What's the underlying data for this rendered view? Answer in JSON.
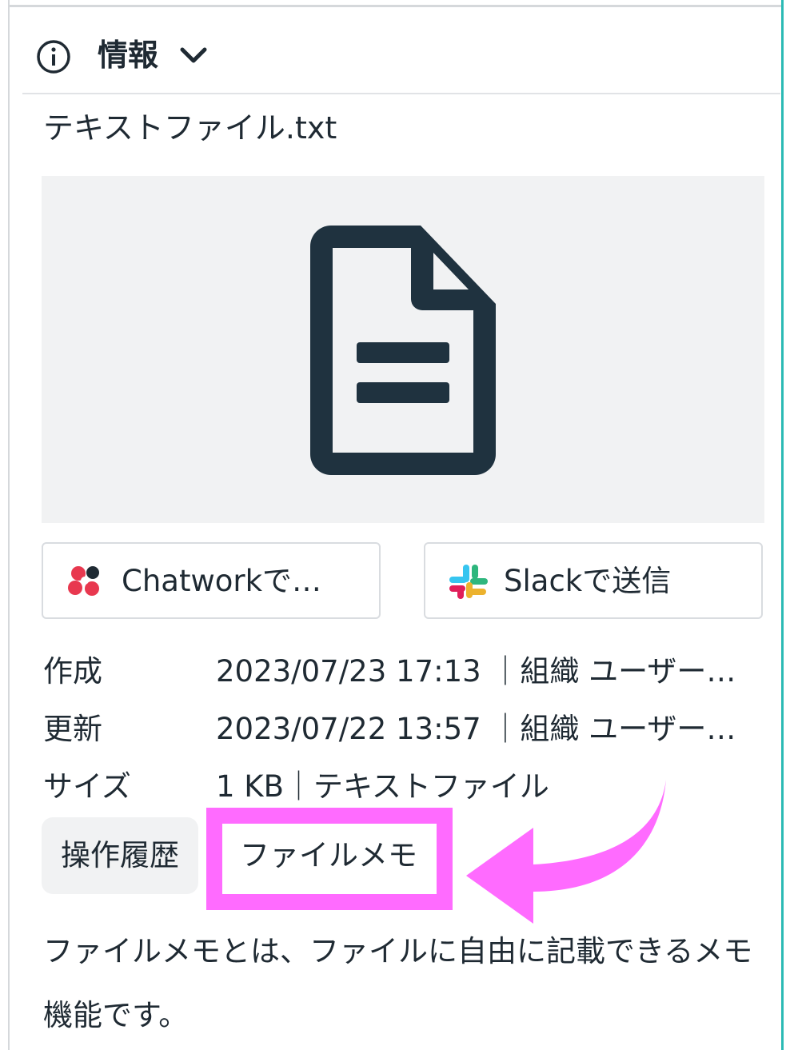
{
  "header": {
    "title": "情報",
    "info_icon": "info-circle-icon",
    "toggle_icon": "chevron-down-icon"
  },
  "file": {
    "name": "テキストファイル.txt",
    "preview_icon": "document-icon"
  },
  "share_buttons": {
    "chatwork": {
      "label": "Chatworkで…",
      "icon": "chatwork-logo-icon"
    },
    "slack": {
      "label": "Slackで送信",
      "icon": "slack-logo-icon"
    }
  },
  "metadata": {
    "created": {
      "label": "作成",
      "value": "2023/07/23 17:13 ｜組織 ユーザー…"
    },
    "updated": {
      "label": "更新",
      "value": "2023/07/22 13:57 ｜組織 ユーザー…"
    },
    "size": {
      "label": "サイズ",
      "value": "1 KB｜テキストファイル"
    }
  },
  "tabs": [
    {
      "label": "操作履歴"
    },
    {
      "label": "ファイルメモ"
    }
  ],
  "description": "ファイルメモとは、ファイルに自由に記載できるメモ機能です。",
  "colors": {
    "accent": "#2bbab5",
    "highlight": "#ff6bff",
    "icon_dark": "#1f323f"
  }
}
